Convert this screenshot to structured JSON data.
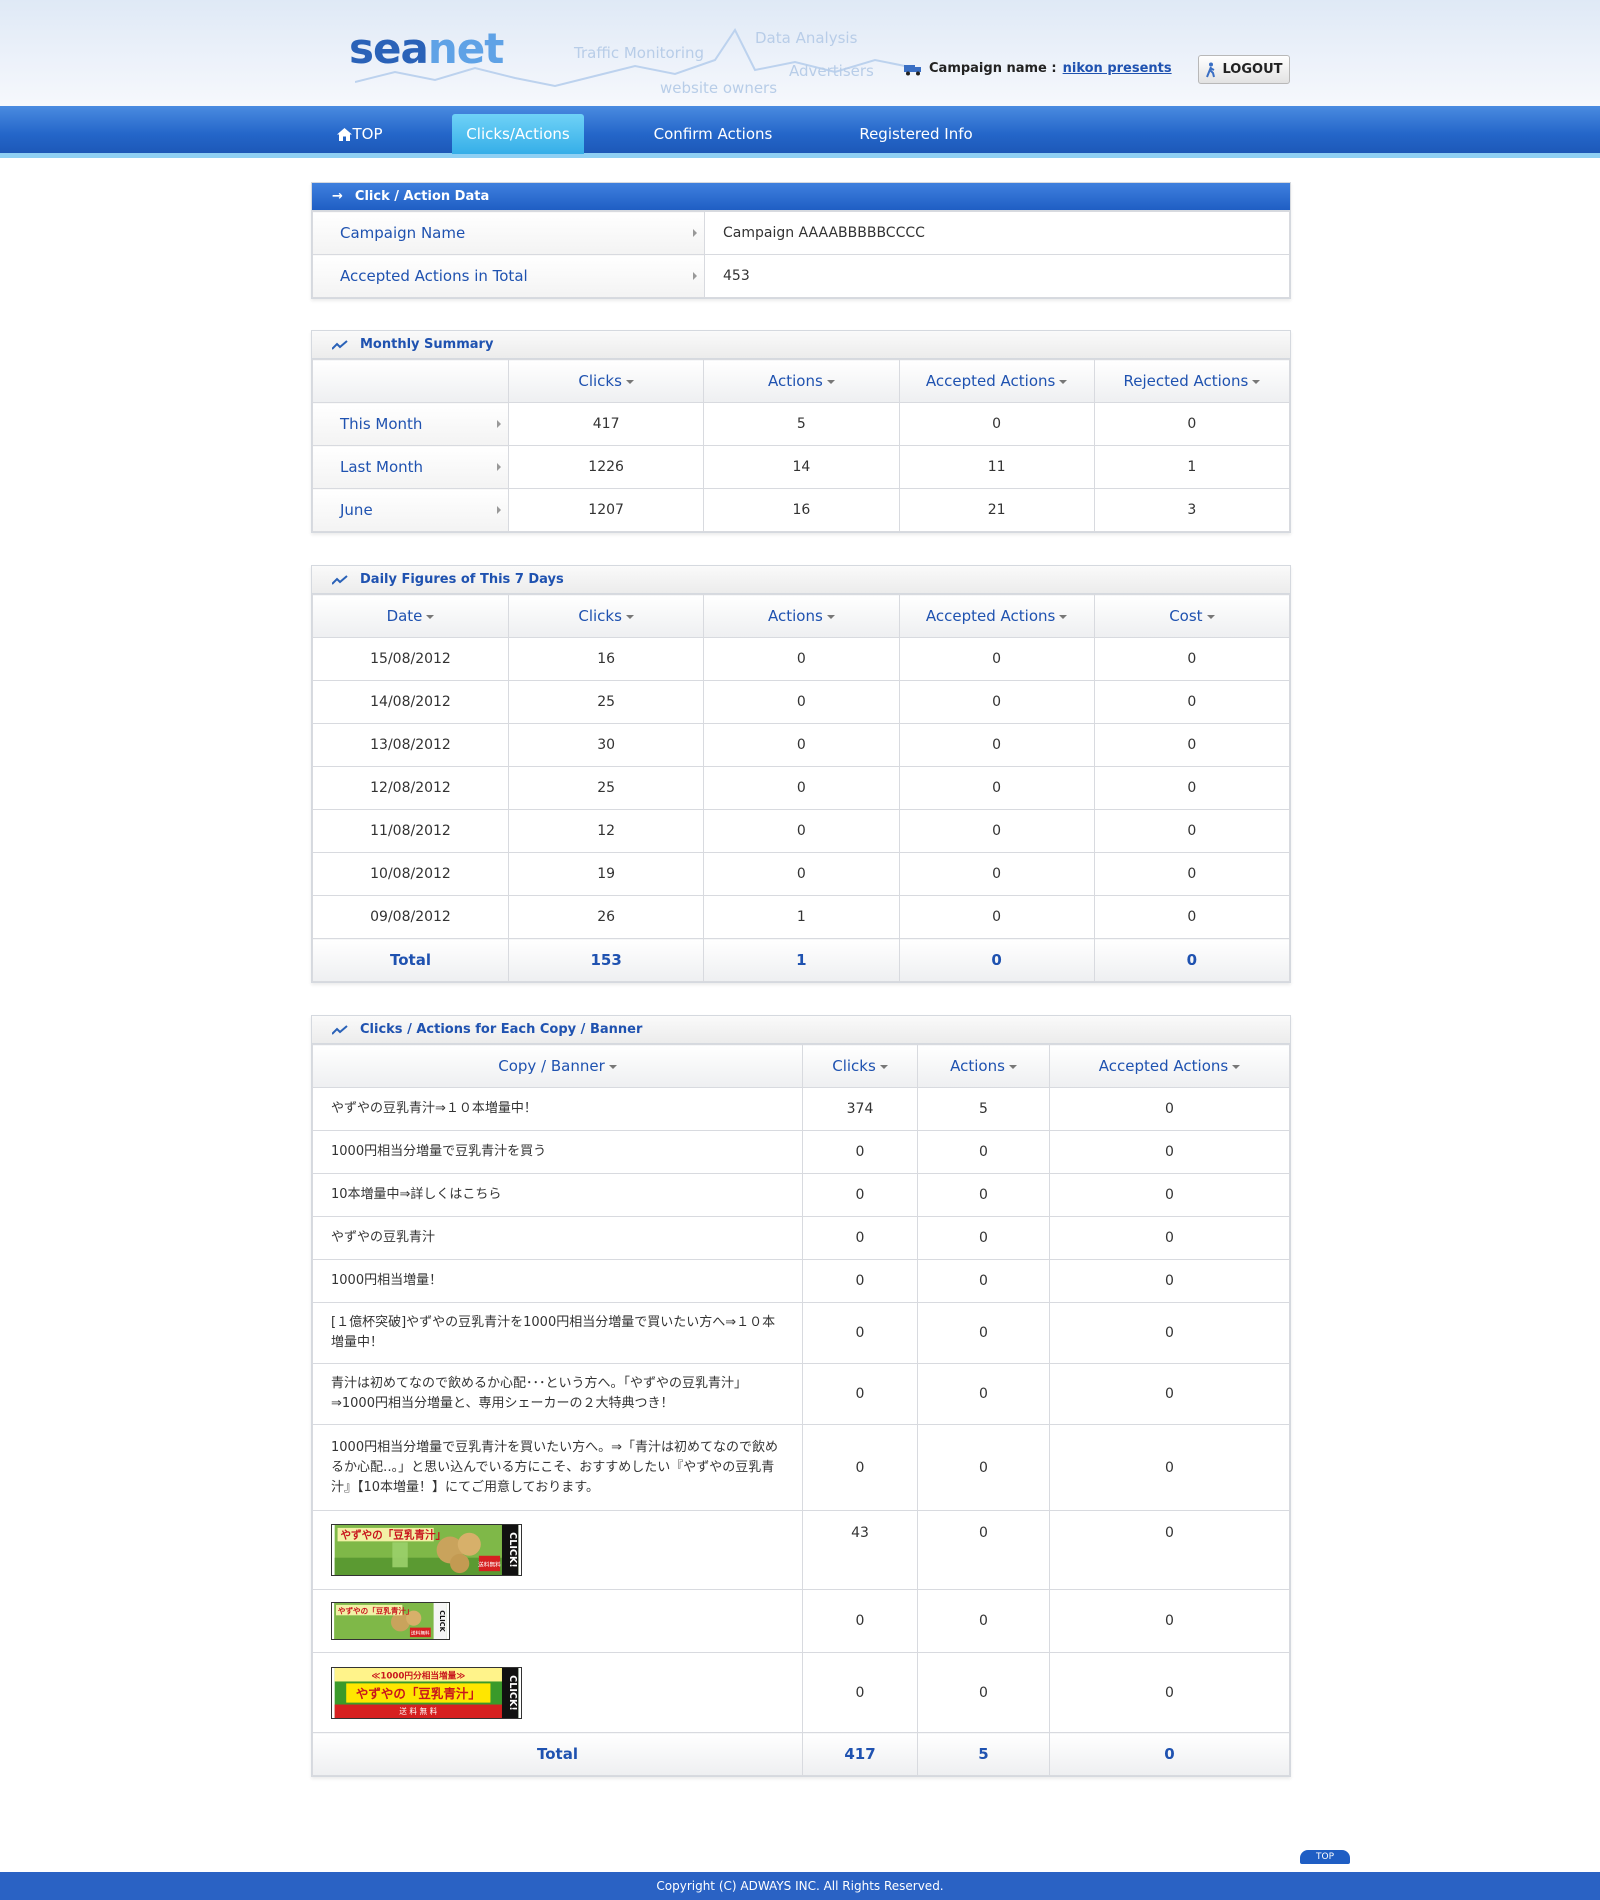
{
  "header": {
    "logo_sea": "sea",
    "logo_net": "net",
    "taglines": [
      "Traffic Monitoring",
      "Data Analysis",
      "Advertisers",
      "website owners"
    ],
    "campaign_label": "Campaign name :",
    "campaign_value": "nikon presents",
    "logout_label": "LOGOUT"
  },
  "nav": {
    "items": [
      {
        "label": "TOP",
        "active": false
      },
      {
        "label": "Clicks/Actions",
        "active": true
      },
      {
        "label": "Confirm Actions",
        "active": false
      },
      {
        "label": "Registered Info",
        "active": false
      }
    ]
  },
  "click_action_data": {
    "title": "Click / Action Data",
    "rows": [
      {
        "label": "Campaign Name",
        "value": "Campaign AAAABBBBBCCCC"
      },
      {
        "label": "Accepted Actions in Total",
        "value": "453"
      }
    ]
  },
  "monthly_summary": {
    "title": "Monthly Summary",
    "columns": [
      "Clicks",
      "Actions",
      "Accepted Actions",
      "Rejected Actions"
    ],
    "rows": [
      {
        "label": "This Month",
        "values": [
          "417",
          "5",
          "0",
          "0"
        ]
      },
      {
        "label": "Last Month",
        "values": [
          "1226",
          "14",
          "11",
          "1"
        ]
      },
      {
        "label": "June",
        "values": [
          "1207",
          "16",
          "21",
          "3"
        ]
      }
    ]
  },
  "daily_figures": {
    "title": "Daily Figures of This 7 Days",
    "columns": [
      "Date",
      "Clicks",
      "Actions",
      "Accepted Actions",
      "Cost"
    ],
    "rows": [
      [
        "15/08/2012",
        "16",
        "0",
        "0",
        "0"
      ],
      [
        "14/08/2012",
        "25",
        "0",
        "0",
        "0"
      ],
      [
        "13/08/2012",
        "30",
        "0",
        "0",
        "0"
      ],
      [
        "12/08/2012",
        "25",
        "0",
        "0",
        "0"
      ],
      [
        "11/08/2012",
        "12",
        "0",
        "0",
        "0"
      ],
      [
        "10/08/2012",
        "19",
        "0",
        "0",
        "0"
      ],
      [
        "09/08/2012",
        "26",
        "1",
        "0",
        "0"
      ]
    ],
    "total": [
      "Total",
      "153",
      "1",
      "0",
      "0"
    ]
  },
  "copy_banner": {
    "title": "Clicks / Actions for Each Copy / Banner",
    "columns": [
      "Copy / Banner",
      "Clicks",
      "Actions",
      "Accepted Actions"
    ],
    "rows": [
      {
        "copy": "やずやの豆乳青汁⇒１０本増量中！",
        "values": [
          "374",
          "5",
          "0"
        ]
      },
      {
        "copy": "1000円相当分増量で豆乳青汁を買う",
        "values": [
          "0",
          "0",
          "0"
        ]
      },
      {
        "copy": "10本増量中⇒詳しくはこちら",
        "values": [
          "0",
          "0",
          "0"
        ]
      },
      {
        "copy": "やずやの豆乳青汁",
        "values": [
          "0",
          "0",
          "0"
        ]
      },
      {
        "copy": "1000円相当増量！",
        "values": [
          "0",
          "0",
          "0"
        ]
      },
      {
        "copy": "[１億杯突破]やずやの豆乳青汁を1000円相当分増量で買いたい方へ⇒１０本増量中！",
        "values": [
          "0",
          "0",
          "0"
        ]
      },
      {
        "copy": "青汁は初めてなので飲めるか心配･･･という方へ。「やずやの豆乳青汁」⇒1000円相当分増量と、専用シェーカーの２大特典つき！",
        "values": [
          "0",
          "0",
          "0"
        ]
      },
      {
        "copy": "1000円相当分増量で豆乳青汁を買いたい方へ。⇒「青汁は初めてなので飲めるか心配‥。」と思い込んでいる方にこそ、おすすめしたい『やずやの豆乳青汁』【10本増量！】にてご用意しております。",
        "values": [
          "0",
          "0",
          "0"
        ]
      }
    ],
    "banners": [
      {
        "text": "やずやの「豆乳青汁」",
        "sub": "送料無料",
        "side": "CLICK!",
        "values": [
          "43",
          "0",
          "0"
        ]
      },
      {
        "text": "やずやの「豆乳青汁」",
        "sub": "送料無料",
        "side": "CLICK",
        "values": [
          "0",
          "0",
          "0"
        ]
      },
      {
        "top": "≪1000円分相当増量≫",
        "text": "やずやの「豆乳青汁」",
        "sub": "送 料 無 料",
        "side": "CLICK!",
        "values": [
          "0",
          "0",
          "0"
        ]
      }
    ],
    "total": [
      "Total",
      "417",
      "5",
      "0"
    ]
  },
  "footer": {
    "top_label": "TOP",
    "copyright": "Copyright (C) ADWAYS INC. All Rights Reserved."
  },
  "colors": {
    "accent": "#1f52b0",
    "nav_blue": "#2466c9",
    "nav_active": "#35aee8"
  }
}
